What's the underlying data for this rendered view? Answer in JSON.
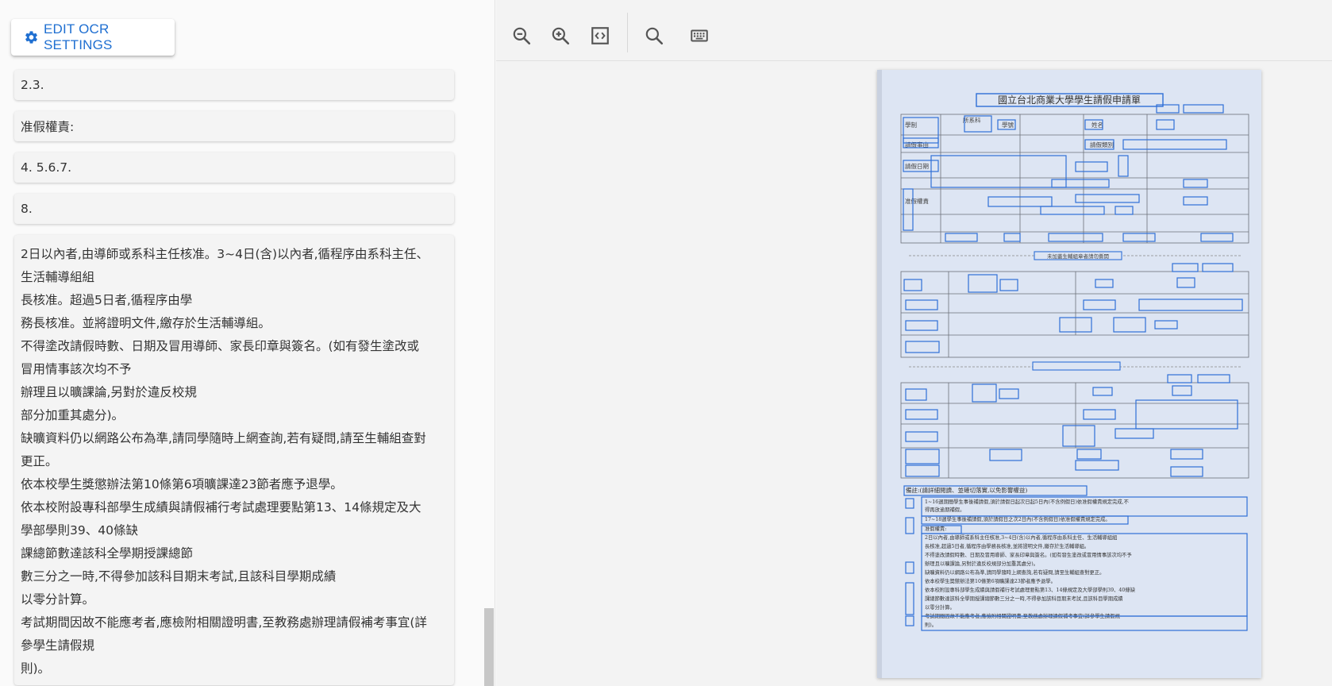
{
  "left_panel": {
    "edit_button_label": "EDIT OCR SETTINGS",
    "edit_button_icon": "gear-icon",
    "accent_color": "#1f6fd1",
    "cards": [
      {
        "lines": [
          "2.3."
        ]
      },
      {
        "lines": [
          "准假權責:"
        ]
      },
      {
        "lines": [
          "4. 5.6.7."
        ]
      },
      {
        "lines": [
          "8."
        ]
      },
      {
        "lines": [
          "2日以內者,由導師或系科主任核准。3~4日(含)以內者,循程序由系科主任、",
          "生活輔導組組",
          "長核准。超過5日者,循程序由學",
          "務長核准。並將證明文件,繳存於生活輔導組。",
          "不得塗改請假時數、日期及冒用導師、家長印章與簽名。(如有發生塗改或",
          "冒用情事該次均不予",
          "辦理且以曠課論,另對於違反校規",
          "部分加重其處分)。",
          "缺曠資料仍以網路公布為準,請同學隨時上網查詢,若有疑問,請至生輔組查對",
          "更正。",
          "依本校學生獎懲辦法第10條第6項曠課達23節者應予退學。",
          "依本校附設專科部學生成績與請假補行考試處理要點第13、14條規定及大",
          "學部學則39、40條缺",
          "課總節數達該科全學期授課總節",
          "數三分之一時,不得參加該科目期末考試,且該科目學期成績",
          "以零分計算。",
          "考試期間因故不能應考者,應檢附相關證明書,至教務處辦理請假補考事宜(詳",
          "參學生請假規",
          "則)。"
        ]
      }
    ]
  },
  "toolbar": {
    "buttons": [
      {
        "name": "zoom-out",
        "icon": "zoom-out-icon"
      },
      {
        "name": "zoom-in",
        "icon": "zoom-in-icon"
      },
      {
        "name": "fit",
        "icon": "code-brackets-icon"
      },
      {
        "name": "search",
        "icon": "search-icon"
      },
      {
        "name": "keyboard",
        "icon": "keyboard-icon"
      }
    ]
  },
  "document": {
    "title": "國立台北商業大學學生請假申請單",
    "box_color": "#2f6fd6",
    "rows": [
      "學制",
      "所系科",
      "學號",
      "姓名",
      "請假事由",
      "請假類別",
      "請假日期",
      "准假權責",
      "導師簽名",
      "備註"
    ],
    "tear_off_label": "未加蓋生輔組章者請勿撕開",
    "notes_heading": "備註:(請詳細閱讀、並確切落實,以免影響權益)",
    "note_lines": [
      "1~16週期間學生事後補請假,須於請假日起次日起5日內(不含例假日)依准假權責規定完成,不",
      "得再放逾期補假。",
      "17~18週學生事後補請假,須於請假日之次2日內(不含例假日)依准假權責規定完成。",
      "准假權責:",
      "2日以內者,由導師或系科主任核准,3~4日(含)以內者,循程序由系科主任、生活輔導組組",
      "長核准,超過5日者,循程序由學務長核准,並將證明文件,繳存於生活輔導組。",
      "不得塗改請假時數、日期及冒用導師、家長印章與簽名。(如有發生塗改或冒用情事該次均不予",
      "辦理且以曠課論,另對於違反校規部分加重其處分)。",
      "缺曠資料仍以網路公布為準,請同學隨時上網查詢,若有疑問,請至生輔組查對更正。",
      "依本校學生獎懲辦法第10條第6項曠課達23節者應予退學。",
      "依本校附設專科部學生成績與請假補行考試處理要點第13、14條規定及大學部學則39、40條缺",
      "課總節數達該科全學期授課總節數三分之一時,不得參加該科目期末考試,且該科目學期成績",
      "以零分計算。",
      "考試期間因故不能應考者,應檢附相關證明書,至教務處辦理請假補考事宜(詳參學生請假規",
      "則)。"
    ]
  }
}
